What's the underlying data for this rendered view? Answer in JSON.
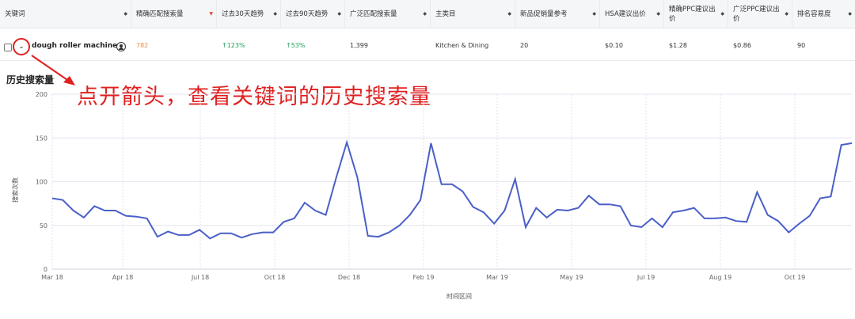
{
  "table": {
    "headers": [
      {
        "label": "关键词",
        "sort": "◆"
      },
      {
        "label": "精确匹配搜索量",
        "sort": "▼"
      },
      {
        "label": "过去30天趋势",
        "sort": "◆"
      },
      {
        "label": "过去90天趋势",
        "sort": "◆"
      },
      {
        "label": "广泛匹配搜索量",
        "sort": "◆"
      },
      {
        "label": "主类目",
        "sort": "◆"
      },
      {
        "label": "新品促销量参考",
        "sort": "◆"
      },
      {
        "label": "HSA建议出价",
        "sort": "◆"
      },
      {
        "label": "精确PPC建议出价",
        "sort": "◆"
      },
      {
        "label": "广泛PPC建议出价",
        "sort": "◆"
      },
      {
        "label": "排名容易度",
        "sort": "◆"
      }
    ],
    "row": {
      "keyword": "dough roller machine",
      "exact_volume": "782",
      "trend_30": "↑123%",
      "trend_90": "↑53%",
      "broad_volume": "1,399",
      "category": "Kitchen & Dining",
      "promo_ref": "20",
      "hsa_bid": "$0.10",
      "exact_ppc": "$1.28",
      "broad_ppc": "$0.86",
      "rank_ease": "90"
    }
  },
  "section_title": "历史搜索量",
  "annotation_text": "点开箭头，查看关键词的历史搜索量",
  "colors": {
    "line": "#4a5fc7",
    "annotation": "#e02020",
    "exact_volume": "#f08c3c",
    "trend_up": "#1e9e5a"
  },
  "chart_data": {
    "type": "line",
    "xlabel": "时间区间",
    "ylabel": "搜索次数",
    "ylim": [
      0,
      200
    ],
    "y_ticks": [
      "0",
      "50",
      "100",
      "150",
      "200"
    ],
    "x_ticks": [
      "Mar 18",
      "Apr 18",
      "Jul 18",
      "Oct 18",
      "Dec 18",
      "Feb 19",
      "Mar 19",
      "May 19",
      "Jul 19",
      "Aug 19",
      "Oct 19"
    ],
    "series": [
      {
        "values": [
          81,
          79,
          67,
          59,
          72,
          67,
          67,
          61,
          60,
          58,
          37,
          43,
          39,
          39,
          45,
          35,
          41,
          41,
          36,
          40,
          42,
          42,
          54,
          58,
          76,
          67,
          62,
          105,
          145,
          105,
          38,
          37,
          42,
          50,
          62,
          79,
          144,
          97,
          97,
          89,
          71,
          65,
          52,
          67,
          103,
          48,
          70,
          59,
          68,
          67,
          70,
          84,
          74,
          74,
          72,
          50,
          48,
          58,
          48,
          65,
          67,
          70,
          58,
          58,
          59,
          55,
          54,
          88,
          62,
          55,
          42,
          52,
          61,
          81,
          83,
          142,
          144
        ]
      }
    ]
  }
}
